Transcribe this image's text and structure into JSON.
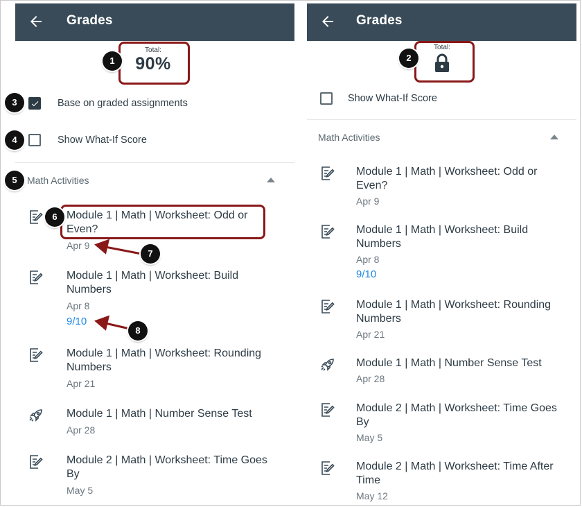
{
  "app_title": "Grades",
  "left": {
    "total_label": "Total:",
    "total_value": "90%",
    "checkbox_graded_label": "Base on graded assignments",
    "checkbox_graded_checked": true,
    "checkbox_whatif_label": "Show What-If Score",
    "checkbox_whatif_checked": false,
    "section_title": "Math Activities",
    "items": [
      {
        "title": "Module 1 | Math | Worksheet: Odd or Even?",
        "date": "Apr 9",
        "score": "",
        "icon": "assignment-icon"
      },
      {
        "title": "Module 1 | Math | Worksheet: Build Numbers",
        "date": "Apr 8",
        "score": "9/10",
        "icon": "assignment-icon"
      },
      {
        "title": "Module 1 | Math | Worksheet: Rounding Numbers",
        "date": "Apr 21",
        "score": "",
        "icon": "assignment-icon"
      },
      {
        "title": "Module 1 | Math | Number Sense Test",
        "date": "Apr 28",
        "score": "",
        "icon": "quiz-rocket-icon"
      },
      {
        "title": "Module 2 | Math | Worksheet: Time Goes By",
        "date": "May 5",
        "score": "",
        "icon": "assignment-icon"
      }
    ]
  },
  "right": {
    "total_label": "Total:",
    "total_icon": "lock-icon",
    "checkbox_whatif_label": "Show What-If Score",
    "checkbox_whatif_checked": false,
    "section_title": "Math Activities",
    "items": [
      {
        "title": "Module 1 | Math | Worksheet: Odd or Even?",
        "date": "Apr 9",
        "score": "",
        "icon": "assignment-icon"
      },
      {
        "title": "Module 1 | Math | Worksheet: Build Numbers",
        "date": "Apr 8",
        "score": "9/10",
        "icon": "assignment-icon"
      },
      {
        "title": "Module 1 | Math | Worksheet: Rounding Numbers",
        "date": "Apr 21",
        "score": "",
        "icon": "assignment-icon"
      },
      {
        "title": "Module 1 | Math | Number Sense Test",
        "date": "Apr 28",
        "score": "",
        "icon": "quiz-rocket-icon"
      },
      {
        "title": "Module 2 | Math | Worksheet: Time Goes By",
        "date": "May 5",
        "score": "",
        "icon": "assignment-icon"
      },
      {
        "title": "Module 2 | Math | Worksheet: Time After Time",
        "date": "May 12",
        "score": "",
        "icon": "assignment-icon"
      }
    ]
  },
  "callouts": [
    "1",
    "2",
    "3",
    "4",
    "5",
    "6",
    "7",
    "8"
  ],
  "colors": {
    "appbar": "#394b58",
    "highlight": "#8a1818",
    "score": "#1e88e5",
    "badge": "#111111"
  }
}
